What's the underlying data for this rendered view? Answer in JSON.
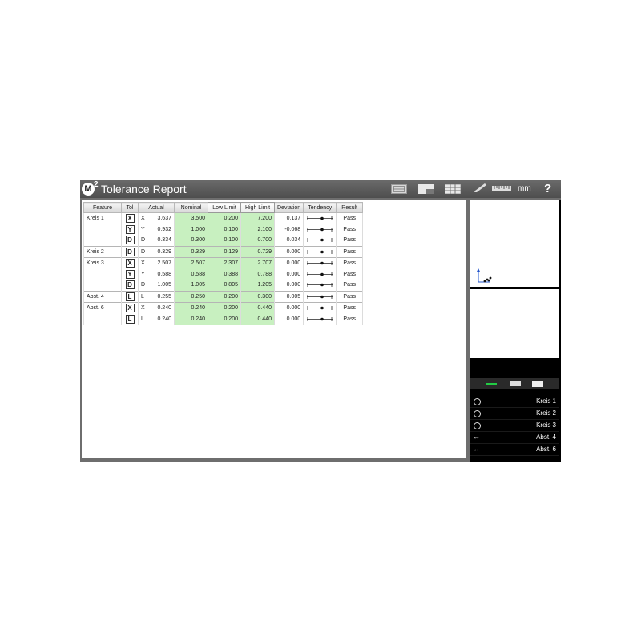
{
  "titlebar": {
    "logo": "M",
    "logo_sup": "2",
    "title": "Tolerance Report",
    "unit": "mm",
    "help": "?"
  },
  "table": {
    "headers": [
      "Feature",
      "Tol",
      "Actual",
      "Nominal",
      "Low Limit",
      "High Limit",
      "Deviation",
      "Tendency",
      "Result"
    ],
    "rows": [
      {
        "feature": "Kreis 1",
        "tol": "X",
        "axis": "X",
        "actual": "3.637",
        "nominal": "3.500",
        "low": "0.200",
        "high": "7.200",
        "dev": "0.137",
        "result": "Pass"
      },
      {
        "feature": "",
        "tol": "Y",
        "axis": "Y",
        "actual": "0.932",
        "nominal": "1.000",
        "low": "0.100",
        "high": "2.100",
        "dev": "-0.068",
        "result": "Pass"
      },
      {
        "feature": "",
        "tol": "D",
        "axis": "D",
        "actual": "0.334",
        "nominal": "0.300",
        "low": "0.100",
        "high": "0.700",
        "dev": "0.034",
        "result": "Pass"
      },
      {
        "feature": "Kreis 2",
        "tol": "D",
        "axis": "D",
        "actual": "0.329",
        "nominal": "0.329",
        "low": "0.129",
        "high": "0.729",
        "dev": "0.000",
        "result": "Pass"
      },
      {
        "feature": "Kreis 3",
        "tol": "X",
        "axis": "X",
        "actual": "2.507",
        "nominal": "2.507",
        "low": "2.307",
        "high": "2.707",
        "dev": "0.000",
        "result": "Pass"
      },
      {
        "feature": "",
        "tol": "Y",
        "axis": "Y",
        "actual": "0.588",
        "nominal": "0.588",
        "low": "0.388",
        "high": "0.788",
        "dev": "0.000",
        "result": "Pass"
      },
      {
        "feature": "",
        "tol": "D",
        "axis": "D",
        "actual": "1.005",
        "nominal": "1.005",
        "low": "0.805",
        "high": "1.205",
        "dev": "0.000",
        "result": "Pass"
      },
      {
        "feature": "Abst. 4",
        "tol": "L",
        "axis": "L",
        "actual": "0.255",
        "nominal": "0.250",
        "low": "0.200",
        "high": "0.300",
        "dev": "0.005",
        "result": "Pass"
      },
      {
        "feature": "Abst. 6",
        "tol": "X",
        "axis": "X",
        "actual": "0.240",
        "nominal": "0.240",
        "low": "0.200",
        "high": "0.440",
        "dev": "0.000",
        "result": "Pass"
      },
      {
        "feature": "",
        "tol": "L",
        "axis": "L",
        "actual": "0.240",
        "nominal": "0.240",
        "low": "0.200",
        "high": "0.440",
        "dev": "0.000",
        "result": "Pass"
      }
    ]
  },
  "features": [
    {
      "icon": "circle-icon",
      "label": "Kreis 1"
    },
    {
      "icon": "circle-icon",
      "label": "Kreis 2"
    },
    {
      "icon": "circle-icon",
      "label": "Kreis 3"
    },
    {
      "icon": "distance-icon",
      "label": "Abst. 4"
    },
    {
      "icon": "distance-icon",
      "label": "Abst. 6"
    }
  ],
  "colors": {
    "within_tolerance": "#c8f0c0",
    "tab_active": "#22cc44"
  }
}
